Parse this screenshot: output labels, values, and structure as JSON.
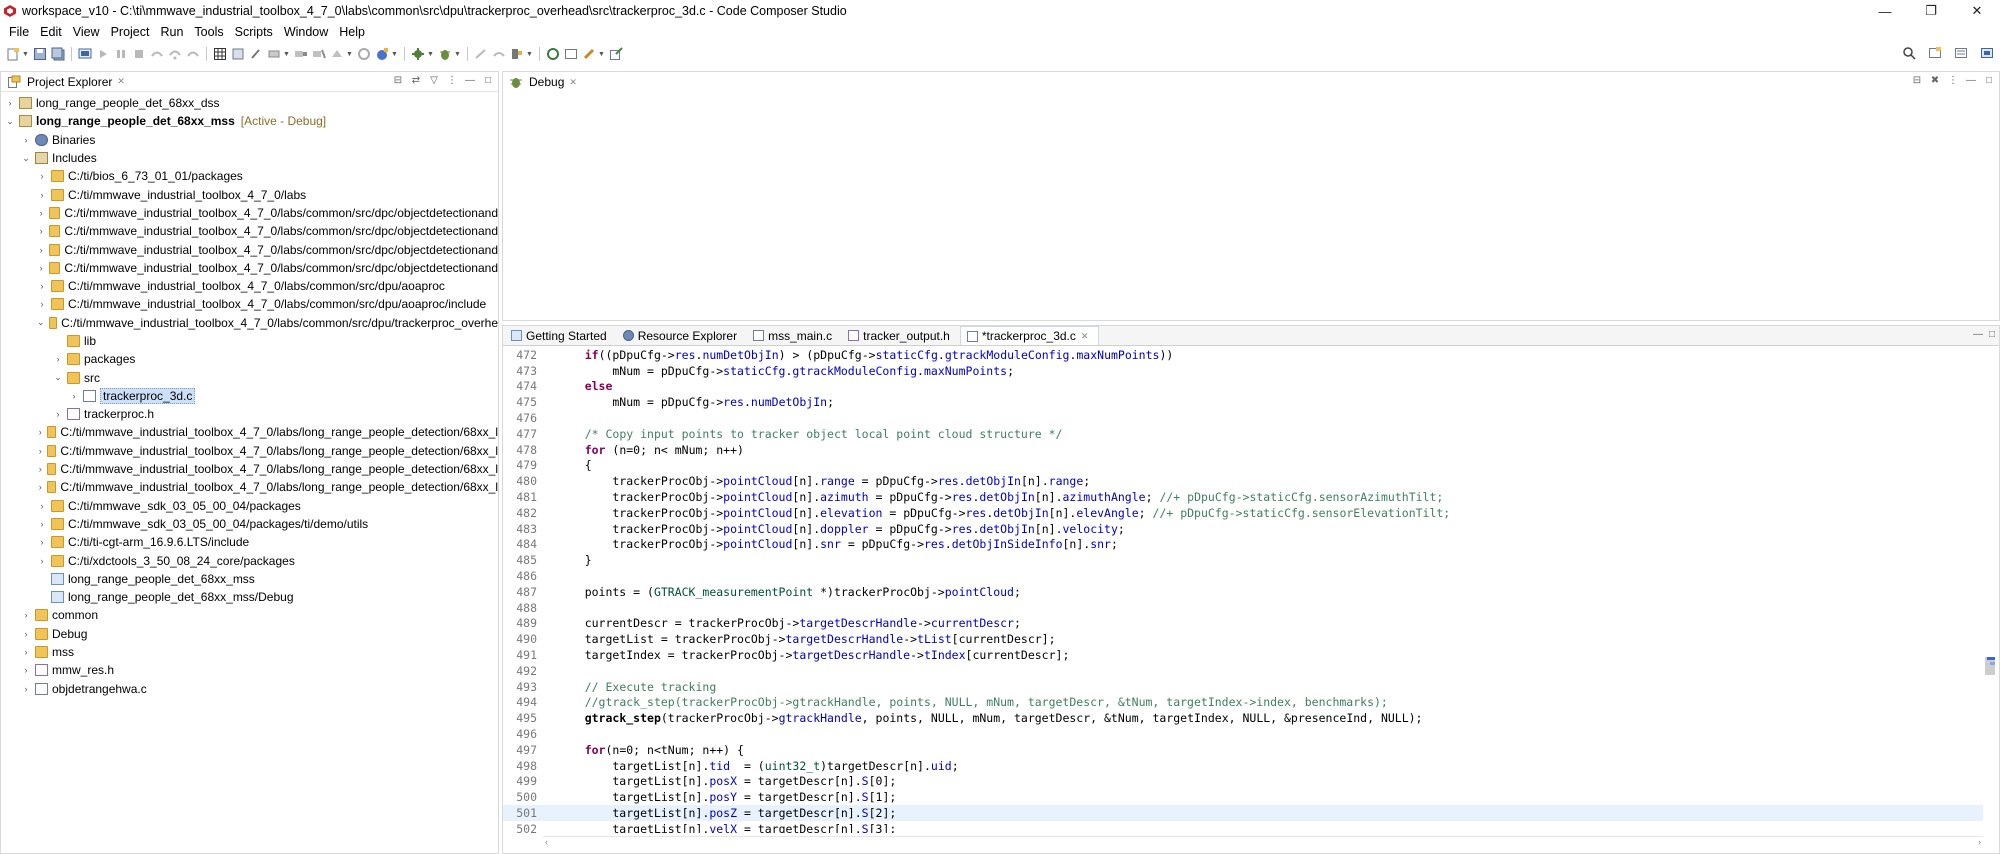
{
  "window": {
    "title": "workspace_v10 - C:\\ti\\mmwave_industrial_toolbox_4_7_0\\labs\\common\\src\\dpu\\trackerproc_overhead\\src\\trackerproc_3d.c - Code Composer Studio",
    "minimize": "—",
    "restore": "❐",
    "close": "✕"
  },
  "menu": [
    "File",
    "Edit",
    "View",
    "Project",
    "Run",
    "Tools",
    "Scripts",
    "Window",
    "Help"
  ],
  "project_explorer": {
    "title": "Project Explorer",
    "close": "✕",
    "items": [
      {
        "indent": 0,
        "twisty": "›",
        "icon": "project",
        "label": "long_range_people_det_68xx_dss"
      },
      {
        "indent": 0,
        "twisty": "⌄",
        "icon": "project",
        "label": "long_range_people_det_68xx_mss",
        "bold": true,
        "active": "[Active - Debug]"
      },
      {
        "indent": 1,
        "twisty": "›",
        "icon": "bin",
        "label": "Binaries"
      },
      {
        "indent": 1,
        "twisty": "⌄",
        "icon": "inc",
        "label": "Includes"
      },
      {
        "indent": 2,
        "twisty": "›",
        "icon": "folder",
        "label": "C:/ti/bios_6_73_01_01/packages"
      },
      {
        "indent": 2,
        "twisty": "›",
        "icon": "folder",
        "label": "C:/ti/mmwave_industrial_toolbox_4_7_0/labs"
      },
      {
        "indent": 2,
        "twisty": "›",
        "icon": "folder",
        "label": "C:/ti/mmwave_industrial_toolbox_4_7_0/labs/common/src/dpc/objectdetectionand"
      },
      {
        "indent": 2,
        "twisty": "›",
        "icon": "folder",
        "label": "C:/ti/mmwave_industrial_toolbox_4_7_0/labs/common/src/dpc/objectdetectionand"
      },
      {
        "indent": 2,
        "twisty": "›",
        "icon": "folder",
        "label": "C:/ti/mmwave_industrial_toolbox_4_7_0/labs/common/src/dpc/objectdetectionand"
      },
      {
        "indent": 2,
        "twisty": "›",
        "icon": "folder",
        "label": "C:/ti/mmwave_industrial_toolbox_4_7_0/labs/common/src/dpc/objectdetectionand"
      },
      {
        "indent": 2,
        "twisty": "›",
        "icon": "folder",
        "label": "C:/ti/mmwave_industrial_toolbox_4_7_0/labs/common/src/dpu/aoaproc"
      },
      {
        "indent": 2,
        "twisty": "›",
        "icon": "folder",
        "label": "C:/ti/mmwave_industrial_toolbox_4_7_0/labs/common/src/dpu/aoaproc/include"
      },
      {
        "indent": 2,
        "twisty": "⌄",
        "icon": "folder",
        "label": "C:/ti/mmwave_industrial_toolbox_4_7_0/labs/common/src/dpu/trackerproc_overhe"
      },
      {
        "indent": 3,
        "twisty": "",
        "icon": "folder",
        "label": "lib"
      },
      {
        "indent": 3,
        "twisty": "›",
        "icon": "folder",
        "label": "packages"
      },
      {
        "indent": 3,
        "twisty": "⌄",
        "icon": "folder",
        "label": "src"
      },
      {
        "indent": 4,
        "twisty": "›",
        "icon": "cfile",
        "label": "trackerproc_3d.c",
        "selected": true
      },
      {
        "indent": 3,
        "twisty": "›",
        "icon": "hfile",
        "label": "trackerproc.h"
      },
      {
        "indent": 2,
        "twisty": "›",
        "icon": "folder",
        "label": "C:/ti/mmwave_industrial_toolbox_4_7_0/labs/long_range_people_detection/68xx_l"
      },
      {
        "indent": 2,
        "twisty": "›",
        "icon": "folder",
        "label": "C:/ti/mmwave_industrial_toolbox_4_7_0/labs/long_range_people_detection/68xx_l"
      },
      {
        "indent": 2,
        "twisty": "›",
        "icon": "folder",
        "label": "C:/ti/mmwave_industrial_toolbox_4_7_0/labs/long_range_people_detection/68xx_l"
      },
      {
        "indent": 2,
        "twisty": "›",
        "icon": "folder",
        "label": "C:/ti/mmwave_industrial_toolbox_4_7_0/labs/long_range_people_detection/68xx_l"
      },
      {
        "indent": 2,
        "twisty": "›",
        "icon": "folder",
        "label": "C:/ti/mmwave_sdk_03_05_00_04/packages"
      },
      {
        "indent": 2,
        "twisty": "›",
        "icon": "folder",
        "label": "C:/ti/mmwave_sdk_03_05_00_04/packages/ti/demo/utils"
      },
      {
        "indent": 2,
        "twisty": "›",
        "icon": "folder",
        "label": "C:/ti/ti-cgt-arm_16.9.6.LTS/include"
      },
      {
        "indent": 2,
        "twisty": "›",
        "icon": "folder",
        "label": "C:/ti/xdctools_3_50_08_24_core/packages"
      },
      {
        "indent": 2,
        "twisty": "",
        "icon": "launch",
        "label": "long_range_people_det_68xx_mss"
      },
      {
        "indent": 2,
        "twisty": "",
        "icon": "launch",
        "label": "long_range_people_det_68xx_mss/Debug"
      },
      {
        "indent": 1,
        "twisty": "›",
        "icon": "folder",
        "label": "common"
      },
      {
        "indent": 1,
        "twisty": "›",
        "icon": "folder",
        "label": "Debug"
      },
      {
        "indent": 1,
        "twisty": "›",
        "icon": "folder",
        "label": "mss"
      },
      {
        "indent": 1,
        "twisty": "›",
        "icon": "hfile",
        "label": "mmw_res.h"
      },
      {
        "indent": 1,
        "twisty": "›",
        "icon": "cfile",
        "label": "objdetrangehwa.c"
      }
    ]
  },
  "debug_view": {
    "title": "Debug",
    "close": "✕"
  },
  "editor": {
    "tabs": [
      {
        "label": "Getting Started",
        "icon": "launch"
      },
      {
        "label": "Resource Explorer",
        "icon": "bin"
      },
      {
        "label": "mss_main.c",
        "icon": "cfile"
      },
      {
        "label": "tracker_output.h",
        "icon": "hfile"
      },
      {
        "label": "*trackerproc_3d.c",
        "icon": "cfile",
        "active": true,
        "close": "✕"
      }
    ],
    "lines": [
      {
        "n": "472",
        "html": "    <span class=\"kw\">if</span>((pDpuCfg-><span class=\"fld\">res</span>.<span class=\"fld\">numDetObjIn</span>) > (pDpuCfg-><span class=\"fld\">staticCfg</span>.<span class=\"fld\">gtrackModuleConfig</span>.<span class=\"fld\">maxNumPoints</span>))"
      },
      {
        "n": "473",
        "html": "        mNum = pDpuCfg-><span class=\"fld\">staticCfg</span>.<span class=\"fld\">gtrackModuleConfig</span>.<span class=\"fld\">maxNumPoints</span>;"
      },
      {
        "n": "474",
        "html": "    <span class=\"kw\">else</span>"
      },
      {
        "n": "475",
        "html": "        mNum = pDpuCfg-><span class=\"fld\">res</span>.<span class=\"fld\">numDetObjIn</span>;"
      },
      {
        "n": "476",
        "html": ""
      },
      {
        "n": "477",
        "html": "    <span class=\"cm\">/* Copy input points to tracker object local point cloud structure */</span>"
      },
      {
        "n": "478",
        "html": "    <span class=\"kw\">for</span> (n=0; n&lt; mNum; n++)"
      },
      {
        "n": "479",
        "html": "    {"
      },
      {
        "n": "480",
        "html": "        trackerProcObj-><span class=\"fld\">pointCloud</span>[n].<span class=\"fld\">range</span> = pDpuCfg-><span class=\"fld\">res</span>.<span class=\"fld\">detObjIn</span>[n].<span class=\"fld\">range</span>;"
      },
      {
        "n": "481",
        "html": "        trackerProcObj-><span class=\"fld\">pointCloud</span>[n].<span class=\"fld\">azimuth</span> = pDpuCfg-><span class=\"fld\">res</span>.<span class=\"fld\">detObjIn</span>[n].<span class=\"fld\">azimuthAngle</span>; <span class=\"cm\">//+ pDpuCfg->staticCfg.sensorAzimuthTilt;</span>"
      },
      {
        "n": "482",
        "html": "        trackerProcObj-><span class=\"fld\">pointCloud</span>[n].<span class=\"fld\">elevation</span> = pDpuCfg-><span class=\"fld\">res</span>.<span class=\"fld\">detObjIn</span>[n].<span class=\"fld\">elevAngle</span>; <span class=\"cm\">//+ pDpuCfg->staticCfg.sensorElevationTilt;</span>"
      },
      {
        "n": "483",
        "html": "        trackerProcObj-><span class=\"fld\">pointCloud</span>[n].<span class=\"fld\">doppler</span> = pDpuCfg-><span class=\"fld\">res</span>.<span class=\"fld\">detObjIn</span>[n].<span class=\"fld\">velocity</span>;"
      },
      {
        "n": "484",
        "html": "        trackerProcObj-><span class=\"fld\">pointCloud</span>[n].<span class=\"fld\">snr</span> = pDpuCfg-><span class=\"fld\">res</span>.<span class=\"fld\">detObjInSideInfo</span>[n].<span class=\"fld\">snr</span>;"
      },
      {
        "n": "485",
        "html": "    }"
      },
      {
        "n": "486",
        "html": ""
      },
      {
        "n": "487",
        "html": "    points = (<span class=\"ty\">GTRACK_measurementPoint</span> *)trackerProcObj-><span class=\"fld\">pointCloud</span>;"
      },
      {
        "n": "488",
        "html": ""
      },
      {
        "n": "489",
        "html": "    currentDescr = trackerProcObj-><span class=\"fld\">targetDescrHandle</span>-><span class=\"fld\">currentDescr</span>;"
      },
      {
        "n": "490",
        "html": "    targetList = trackerProcObj-><span class=\"fld\">targetDescrHandle</span>-><span class=\"fld\">tList</span>[currentDescr];"
      },
      {
        "n": "491",
        "html": "    targetIndex = trackerProcObj-><span class=\"fld\">targetDescrHandle</span>-><span class=\"fld\">tIndex</span>[currentDescr];"
      },
      {
        "n": "492",
        "html": ""
      },
      {
        "n": "493",
        "html": "    <span class=\"cm\">// Execute tracking</span>"
      },
      {
        "n": "494",
        "html": "    <span class=\"cm\">//gtrack_step(trackerProcObj->gtrackHandle, points, NULL, mNum, targetDescr, &amp;tNum, targetIndex->index, benchmarks);</span>"
      },
      {
        "n": "495",
        "html": "    <span class=\"fn\">gtrack_step</span>(trackerProcObj-><span class=\"fld\">gtrackHandle</span>, points, NULL, mNum, targetDescr, &amp;tNum, targetIndex, NULL, &amp;presenceInd, NULL);"
      },
      {
        "n": "496",
        "html": ""
      },
      {
        "n": "497",
        "html": "    <span class=\"kw\">for</span>(n=0; n&lt;tNum; n++) {"
      },
      {
        "n": "498",
        "html": "        targetList[n].<span class=\"fld\">tid</span>  = (<span class=\"ty\">uint32_t</span>)targetDescr[n].<span class=\"fld\">uid</span>;"
      },
      {
        "n": "499",
        "html": "        targetList[n].<span class=\"fld\">posX</span> = targetDescr[n].<span class=\"fld\">S</span>[0];"
      },
      {
        "n": "500",
        "html": "        targetList[n].<span class=\"fld\">posY</span> = targetDescr[n].<span class=\"fld\">S</span>[1];"
      },
      {
        "n": "501",
        "html": "        targetList[n].<span class=\"fld\">posZ</span> = targetDescr[n].<span class=\"fld\">S</span>[2];",
        "highlight": true
      },
      {
        "n": "502",
        "html": "        targetList[n].<span class=\"fld\">velX</span> = targetDescr[n].<span class=\"fld\">S</span>[3];"
      }
    ]
  }
}
